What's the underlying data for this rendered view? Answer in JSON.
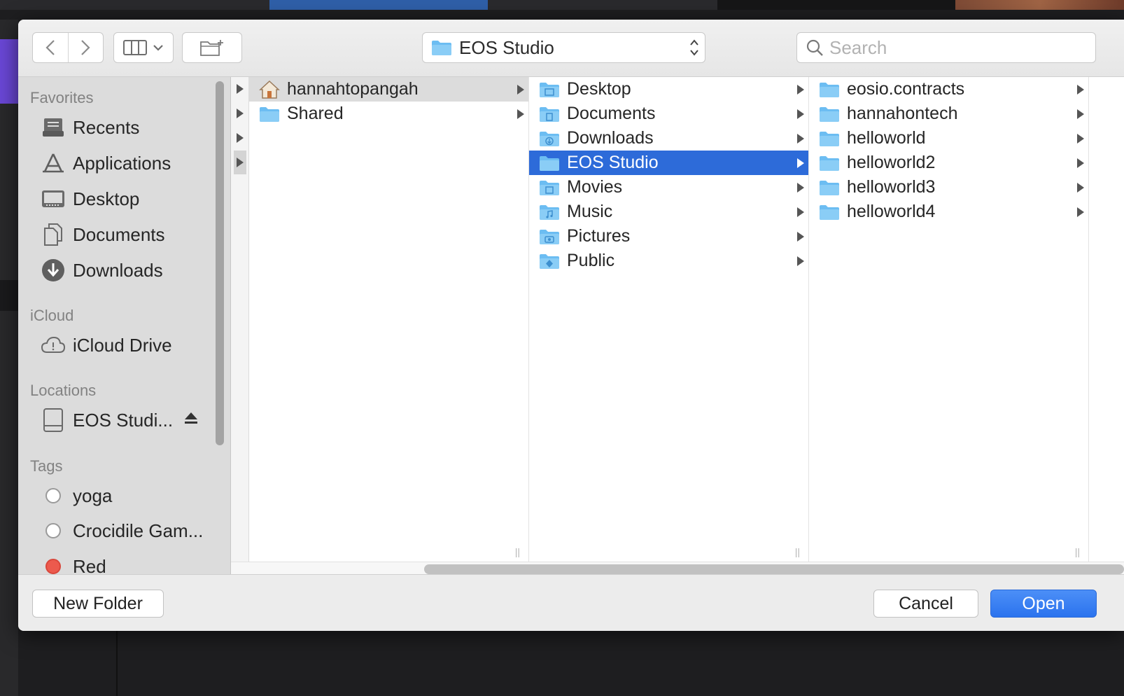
{
  "toolbar": {
    "path_label": "EOS Studio",
    "search_placeholder": "Search"
  },
  "sidebar": {
    "favorites_heading": "Favorites",
    "favorites": [
      {
        "label": "Recents",
        "icon": "recents-icon"
      },
      {
        "label": "Applications",
        "icon": "applications-icon"
      },
      {
        "label": "Desktop",
        "icon": "desktop-icon"
      },
      {
        "label": "Documents",
        "icon": "documents-icon"
      },
      {
        "label": "Downloads",
        "icon": "downloads-icon"
      }
    ],
    "icloud_heading": "iCloud",
    "icloud": [
      {
        "label": "iCloud Drive",
        "icon": "icloud-icon"
      }
    ],
    "locations_heading": "Locations",
    "locations": [
      {
        "label": "EOS Studi...",
        "icon": "drive-icon"
      }
    ],
    "tags_heading": "Tags",
    "tags": [
      {
        "label": "yoga",
        "color": "#ffffff"
      },
      {
        "label": "Crocidile Gam...",
        "color": "#ffffff"
      },
      {
        "label": "Red",
        "color": "#ec5a4d"
      }
    ]
  },
  "columns": {
    "col1": [
      {
        "label": "hannahtopangah",
        "icon": "home-folder-icon"
      },
      {
        "label": "Shared",
        "icon": "folder-icon"
      }
    ],
    "col2": [
      {
        "label": "Desktop",
        "icon": "desktop-folder-icon"
      },
      {
        "label": "Documents",
        "icon": "documents-folder-icon"
      },
      {
        "label": "Downloads",
        "icon": "downloads-folder-icon"
      },
      {
        "label": "EOS Studio",
        "icon": "folder-icon"
      },
      {
        "label": "Movies",
        "icon": "movies-folder-icon"
      },
      {
        "label": "Music",
        "icon": "music-folder-icon"
      },
      {
        "label": "Pictures",
        "icon": "pictures-folder-icon"
      },
      {
        "label": "Public",
        "icon": "public-folder-icon"
      }
    ],
    "col3": [
      {
        "label": "eosio.contracts",
        "icon": "folder-icon"
      },
      {
        "label": "hannahontech",
        "icon": "folder-icon"
      },
      {
        "label": "helloworld",
        "icon": "folder-icon"
      },
      {
        "label": "helloworld2",
        "icon": "folder-icon"
      },
      {
        "label": "helloworld3",
        "icon": "folder-icon"
      },
      {
        "label": "helloworld4",
        "icon": "folder-icon"
      }
    ]
  },
  "footer": {
    "new_folder": "New Folder",
    "cancel": "Cancel",
    "open": "Open"
  },
  "colors": {
    "accent": "#2d6bd9",
    "folder": "#6cbdf2",
    "tag_red": "#ec5a4d"
  }
}
